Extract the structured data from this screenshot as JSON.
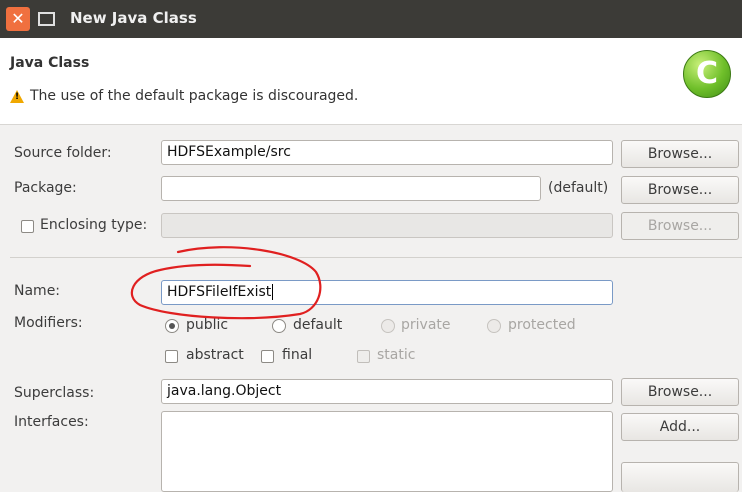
{
  "window": {
    "title": "New Java Class"
  },
  "header": {
    "title": "Java Class",
    "warning": "The use of the default package is discouraged.",
    "icon_letter": "C"
  },
  "source_folder": {
    "label": "Source folder:",
    "value": "HDFSExample/src",
    "button": "Browse..."
  },
  "package": {
    "label": "Package:",
    "value": "",
    "suffix": "(default)",
    "button": "Browse..."
  },
  "enclosing_type": {
    "label": "Enclosing type:",
    "value": "",
    "button": "Browse...",
    "checked": false
  },
  "name": {
    "label": "Name:",
    "value": "HDFSFileIfExist"
  },
  "modifiers": {
    "label": "Modifiers:",
    "access": [
      "public",
      "default",
      "private",
      "protected"
    ],
    "selected": "public",
    "flags": [
      "abstract",
      "final",
      "static"
    ]
  },
  "superclass": {
    "label": "Superclass:",
    "value": "java.lang.Object",
    "button": "Browse..."
  },
  "interfaces": {
    "label": "Interfaces:",
    "button": "Add..."
  },
  "colors": {
    "titlebar": "#3c3b37",
    "close": "#f0703f",
    "annotation": "#e02020",
    "icon_green": "#6fbf2a"
  }
}
